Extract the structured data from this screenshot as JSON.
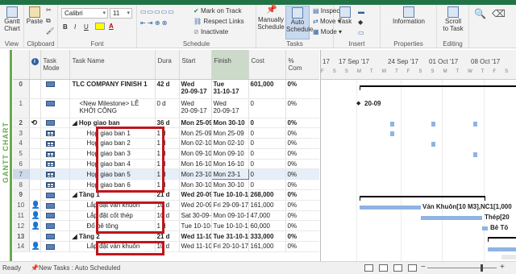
{
  "ribbon": {
    "gantt_chart": "Gantt\nChart",
    "view": "View",
    "paste": "Paste",
    "clipboard": "Clipboard",
    "font_name": "Calibri",
    "font_size": "11",
    "bold": "B",
    "italic": "I",
    "underline": "U",
    "font": "Font",
    "mark_on_track": "Mark on Track",
    "respect_links": "Respect Links",
    "inactivate": "Inactivate",
    "schedule": "Schedule",
    "manually_schedule": "Manually\nSchedule",
    "auto_schedule": "Auto\nSchedule",
    "inspect": "Inspect",
    "move": "Move",
    "mode": "Mode",
    "tasks": "Tasks",
    "task": "Task",
    "insert": "Insert",
    "information": "Information",
    "properties": "Properties",
    "scroll_to_task": "Scroll\nto Task",
    "editing": "Editing"
  },
  "sidebar_label": "GANTT CHART",
  "columns": [
    "Task Mode",
    "Task Name",
    "Duration",
    "Start",
    "Finish",
    "Cost",
    "% Complete"
  ],
  "columns_display": [
    "Task\nMode",
    "Task Name",
    "Dura",
    "Start",
    "Finish",
    "Cost",
    "%\nCom"
  ],
  "rows": [
    {
      "id": "0",
      "mode": "auto",
      "name": "TLC COMPANY FINISH 1",
      "dur": "42 d",
      "start": "Wed\n20-09-17",
      "finish": "Tue\n31-10-17",
      "cost": "601,000",
      "pct": "0%",
      "summary": true,
      "tall": true,
      "indent": 0
    },
    {
      "id": "1",
      "mode": "auto",
      "name": "<New Milestone> LỄ\nKHỞI CÔNG",
      "dur": "0 d",
      "start": "Wed\n20-09-17",
      "finish": "Wed\n20-09-17",
      "cost": "0",
      "pct": "0%",
      "summary": false,
      "tall": true,
      "indent": 1
    },
    {
      "id": "2",
      "mode": "auto",
      "name": "◢ Họp giao ban",
      "dur": "36 d",
      "start": "Mon 25-09",
      "finish": "Mon 30-10",
      "cost": "0",
      "pct": "0%",
      "summary": true,
      "indent": 0,
      "recurring": true
    },
    {
      "id": "3",
      "mode": "grid",
      "name": "Họp giao ban 1",
      "dur": "1 d",
      "start": "Mon 25-09",
      "finish": "Mon 25-09",
      "cost": "0",
      "pct": "0%",
      "indent": 2
    },
    {
      "id": "4",
      "mode": "grid",
      "name": "Họp giao ban 2",
      "dur": "1 d",
      "start": "Mon 02-10",
      "finish": "Mon 02-10",
      "cost": "0",
      "pct": "0%",
      "indent": 2
    },
    {
      "id": "5",
      "mode": "grid",
      "name": "Họp giao ban 3",
      "dur": "1 d",
      "start": "Mon 09-10",
      "finish": "Mon 09-10",
      "cost": "0",
      "pct": "0%",
      "indent": 2
    },
    {
      "id": "6",
      "mode": "grid",
      "name": "Họp giao ban 4",
      "dur": "1 d",
      "start": "Mon 16-10",
      "finish": "Mon 16-10",
      "cost": "0",
      "pct": "0%",
      "indent": 2
    },
    {
      "id": "7",
      "mode": "grid",
      "name": "Họp giao ban 5",
      "dur": "1 d",
      "start": "Mon 23-10",
      "finish": "Mon 23-1",
      "cost": "0",
      "pct": "0%",
      "indent": 2,
      "selected": true
    },
    {
      "id": "8",
      "mode": "grid",
      "name": "Họp giao ban 6",
      "dur": "1 d",
      "start": "Mon 30-10",
      "finish": "Mon 30-10",
      "cost": "0",
      "pct": "0%",
      "indent": 2
    },
    {
      "id": "9",
      "mode": "auto",
      "name": "◢ Tầng 1",
      "dur": "21 d",
      "start": "Wed 20-09",
      "finish": "Tue 10-10-1",
      "cost": "268,000",
      "pct": "0%",
      "summary": true,
      "indent": 0
    },
    {
      "id": "10",
      "mode": "auto",
      "name": "Lắp đặt ván khuôn",
      "dur": "10 d",
      "start": "Wed 20-09",
      "finish": "Fri 29-09-17",
      "cost": "161,000",
      "pct": "0%",
      "indent": 2,
      "person": true
    },
    {
      "id": "11",
      "mode": "auto",
      "name": "Lắp đặt cốt thép",
      "dur": "10 d",
      "start": "Sat 30-09-",
      "finish": "Mon 09-10-17",
      "cost": "47,000",
      "pct": "0%",
      "indent": 2,
      "person": true
    },
    {
      "id": "12",
      "mode": "auto",
      "name": "Đổ bê tông",
      "dur": "1 d",
      "start": "Tue 10-10-",
      "finish": "Tue 10-10-17",
      "cost": "60,000",
      "pct": "0%",
      "indent": 2,
      "person": true
    },
    {
      "id": "13",
      "mode": "auto",
      "name": "◢ Tầng 2",
      "dur": "21 d",
      "start": "Wed 11-10",
      "finish": "Tue 31-10-1",
      "cost": "333,000",
      "pct": "0%",
      "summary": true,
      "indent": 0
    },
    {
      "id": "14",
      "mode": "auto",
      "name": "Lắp đặt ván khuôn",
      "dur": "10 d",
      "start": "Wed 11-10",
      "finish": "Fri 20-10-17",
      "cost": "161,000",
      "pct": "0%",
      "indent": 2,
      "person": true
    }
  ],
  "timescale": [
    "17",
    "17 Sep '17",
    "24 Sep '17",
    "01 Oct '17",
    "08 Oct '17"
  ],
  "gantt_labels": {
    "milestone": "20-09",
    "row10": "Ván Khuôn[10 M3],NC1[1,000",
    "row11": "Thép[20",
    "row12": "Bê Tô"
  },
  "status": {
    "ready": "Ready",
    "new_tasks": "New Tasks : Auto Scheduled"
  },
  "colors": {
    "accent_green": "#217346",
    "highlight_red": "#c0161b",
    "bar_blue": "#8eb4e3"
  }
}
